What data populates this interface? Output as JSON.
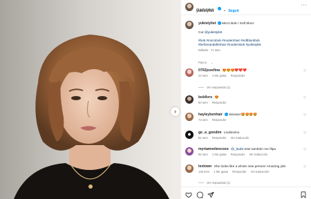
{
  "post": {
    "username": "yukistylist",
    "follow_label": "Seguir",
    "location": "OLLIN Salon",
    "menu_icon": "more-horizontal-icon"
  },
  "caption": {
    "username": "yukistylist",
    "text": "Micro Bob / Soft blunt",
    "line2_prefix": "Cut",
    "line2_mention": "@yukistylist",
    "hashtags_line1": "#bob #microbob #modernhair #softbluntbob",
    "hashtags_line2": "#beforeandafterhair #modernbob #yukistylist",
    "meta": "Editado · 71 sem"
  },
  "para_ti_label": "Para ti",
  "comments": [
    {
      "username": "0702josefina",
      "text": "😍😍😍❤️❤️❤️",
      "time": "22 sem",
      "likes": "1 Me gusta",
      "reply": "Responder",
      "replies": "Ver respuestas (1)"
    },
    {
      "username": "bobllvrs",
      "text": "😍",
      "time": "60 sem",
      "likes": "",
      "reply": "Responder"
    },
    {
      "username": "hayleybenhair",
      "text": "Wowser🤩🤩🤩🤩",
      "time": "73 sem",
      "likes": "",
      "reply": "Responder",
      "verified": true
    },
    {
      "username": "ge_a_gondim",
      "text": "Lindissimo",
      "time": "81 sem",
      "likes": "",
      "reply": "Responder",
      "translate": "Ver traducción"
    },
    {
      "username": "myriamvelencoso",
      "mention": "@_laubt",
      "text": "este también me flipa",
      "time": "82 sem",
      "likes": "1 Me gusta",
      "reply": "Responder",
      "translate": "Ver traducción"
    },
    {
      "username": "lextown",
      "text": "She looks like a whole new person! Amazing job!",
      "time": "146 sem",
      "likes": "1 Me gusta",
      "reply": "Responder",
      "translate": "Ver traducción",
      "replies": "Ver respuestas (1)"
    }
  ],
  "actions": [
    "like-icon",
    "comment-icon",
    "share-icon",
    "save-icon"
  ],
  "colors": {
    "accent": "#0095f6",
    "muted": "#737373",
    "text": "#262626",
    "link": "#00376b"
  }
}
